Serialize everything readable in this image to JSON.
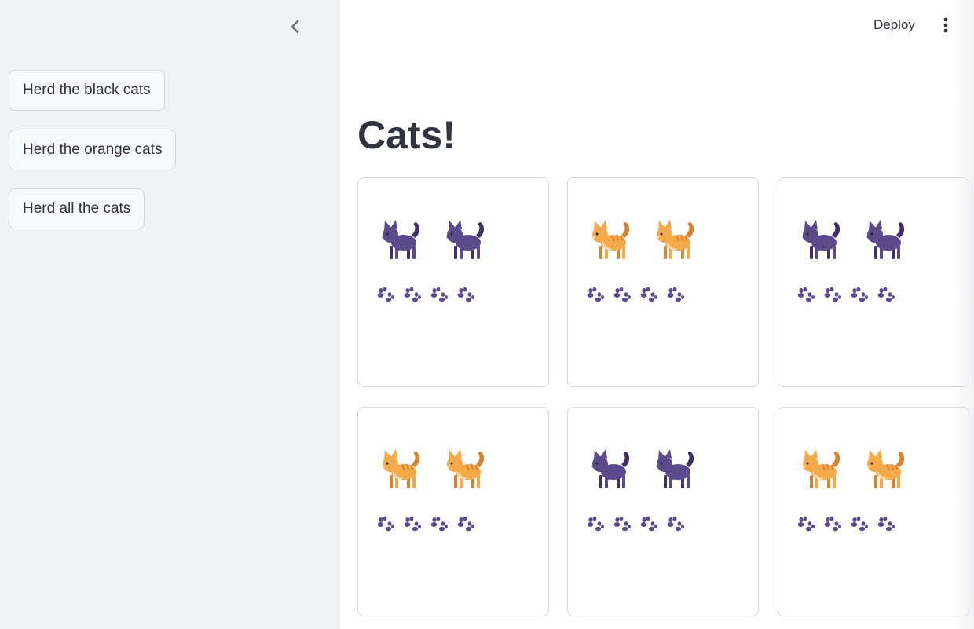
{
  "sidebar": {
    "collapse_icon": "chevron-left-icon",
    "buttons": [
      {
        "label": "Herd the black cats"
      },
      {
        "label": "Herd the orange cats"
      },
      {
        "label": "Herd all the cats"
      }
    ]
  },
  "header": {
    "deploy_label": "Deploy",
    "menu_icon": "more-vertical-icon"
  },
  "main": {
    "title": "Cats!",
    "cards": [
      {
        "cat_color": "black",
        "cat_icon": "cat-icon",
        "cat_count": 2,
        "paw_count": 4
      },
      {
        "cat_color": "orange",
        "cat_icon": "cat-icon",
        "cat_count": 2,
        "paw_count": 4
      },
      {
        "cat_color": "black",
        "cat_icon": "cat-icon",
        "cat_count": 2,
        "paw_count": 4
      },
      {
        "cat_color": "orange",
        "cat_icon": "cat-icon",
        "cat_count": 2,
        "paw_count": 4
      },
      {
        "cat_color": "black",
        "cat_icon": "cat-icon",
        "cat_count": 2,
        "paw_count": 4
      },
      {
        "cat_color": "orange",
        "cat_icon": "cat-icon",
        "cat_count": 2,
        "paw_count": 4
      }
    ]
  },
  "colors": {
    "sidebar_bg": "#f0f2f6",
    "text": "#31333f",
    "border": "#d6d7db",
    "black_cat": "#5c4a8c",
    "black_cat_dark": "#3f2f6b",
    "orange_cat": "#f4a94a",
    "orange_cat_stripe": "#d9822b",
    "orange_cat_light": "#fbd9a8",
    "paw": "#5c4a8c"
  }
}
